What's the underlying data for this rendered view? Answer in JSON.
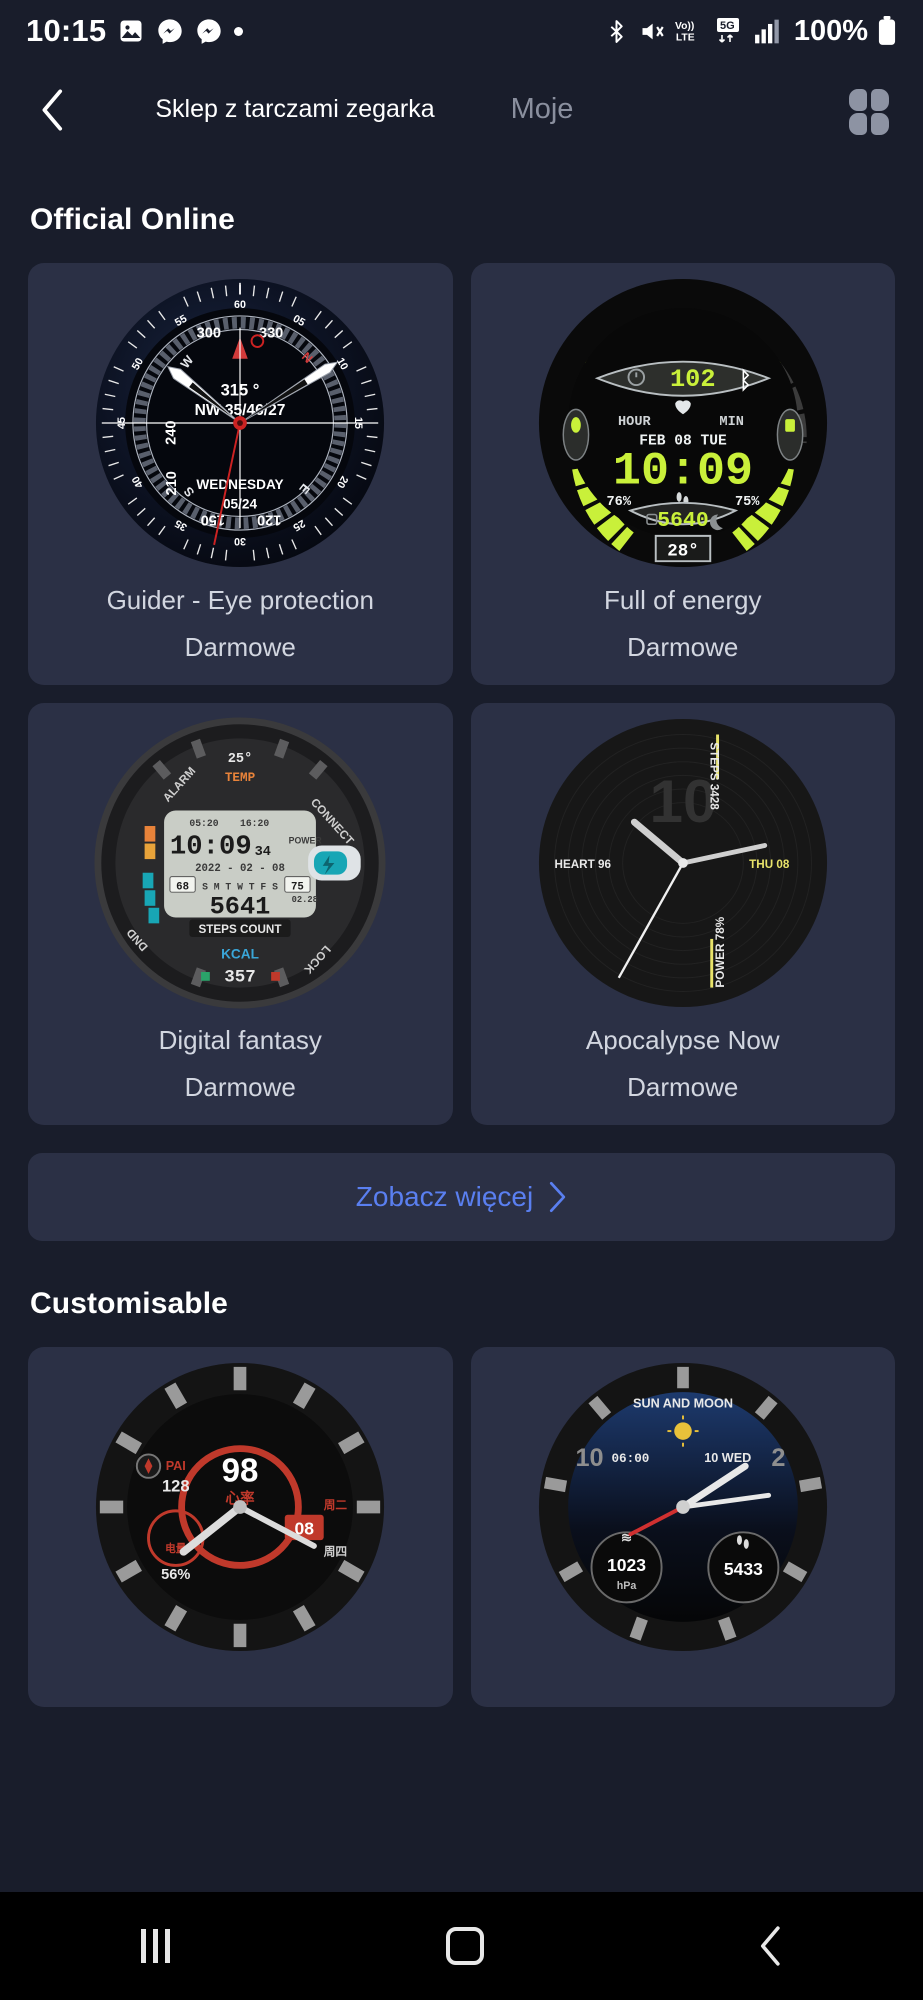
{
  "status_bar": {
    "time": "10:15",
    "battery_percent": "100%",
    "left_icons": [
      "photos-icon",
      "messenger-icon",
      "messenger-icon",
      "dot-icon"
    ],
    "right_icons": [
      "bluetooth-icon",
      "mute-icon",
      "volte-icon",
      "5g-icon",
      "signal-icon",
      "battery-icon"
    ],
    "network_volte_label": "Vo)) LTE",
    "network_5g_label": "5G"
  },
  "app_bar": {
    "back_icon": "chevron-left-icon",
    "title": "Sklep z tarczami zegarka",
    "tab_label": "Moje",
    "grid_icon": "grid-apps-icon"
  },
  "sections": [
    {
      "id": "official-online",
      "title": "Official Online",
      "cards": [
        {
          "name": "Guider - Eye protection",
          "price": "Darmowe",
          "face": "compass"
        },
        {
          "name": "Full of energy",
          "price": "Darmowe",
          "face": "energy"
        },
        {
          "name": "Digital fantasy",
          "price": "Darmowe",
          "face": "digital"
        },
        {
          "name": "Apocalypse Now",
          "price": "Darmowe",
          "face": "apocalypse"
        }
      ],
      "more_label": "Zobacz więcej",
      "more_icon": "chevron-right-icon"
    },
    {
      "id": "customisable",
      "title": "Customisable",
      "cards": [
        {
          "name": "",
          "price": "",
          "face": "pai"
        },
        {
          "name": "",
          "price": "",
          "face": "sunmoon"
        }
      ]
    }
  ],
  "watch_faces": {
    "compass": {
      "bearing": "315",
      "bearing_unit": "°",
      "coords": "NW 35/46/27",
      "weekday": "WEDNESDAY",
      "date": "05/24",
      "compass_labels": [
        "300",
        "330",
        "240",
        "210",
        "150",
        "120"
      ],
      "cardinals": [
        "N",
        "W",
        "S",
        "E"
      ],
      "minute_ticks": [
        "60",
        "55",
        "50",
        "45",
        "40",
        "35",
        "30",
        "25",
        "20",
        "15",
        "10",
        "05"
      ]
    },
    "energy": {
      "alarm_value": "102",
      "hour_label": "HOUR",
      "min_label": "MIN",
      "date": "FEB 08 TUE",
      "time": "10:09",
      "left_percent": "76%",
      "right_percent": "75%",
      "steps": "5640",
      "temperature": "28°",
      "icons": [
        "alarm-icon",
        "bluetooth-icon",
        "heart-icon",
        "footsteps-icon",
        "lock-icon",
        "moon-icon",
        "water-drop-icon",
        "battery-icon"
      ]
    },
    "digital": {
      "temp_top": "25°",
      "temp_label": "TEMP",
      "alarm_label": "ALARM",
      "connect_label": "CONNECT",
      "time": "10:09",
      "seconds": "34",
      "alarm_times": [
        "05:20",
        "16:20"
      ],
      "date": "2022 - 02 - 08",
      "power_label": "POWER",
      "left_val": "68",
      "right_val": "75",
      "week_days": "S M T W T F S",
      "small_date": "02.28",
      "steps": "5641",
      "steps_label": "STEPS COUNT",
      "kcal_label": "KCAL",
      "kcal": "357",
      "dnd_label": "DND",
      "lock_label": "LOCK"
    },
    "apocalypse": {
      "hour_big": "10",
      "steps_label": "STEPS 3428",
      "heart_label": "HEART 96",
      "day_label": "THU 08",
      "power_label": "POWER 78%"
    },
    "pai": {
      "pai_label": "PAI",
      "pai_value": "128",
      "center_value": "98",
      "center_label": "心率",
      "date_value": "08",
      "percent": "56%",
      "side_labels": [
        "周二",
        "周四"
      ],
      "sub_label": "电量"
    },
    "sunmoon": {
      "title": "SUN AND MOON",
      "time_small": "06:00",
      "day_label": "10 WED",
      "pressure": "1023",
      "pressure_unit": "hPa",
      "steps": "5433"
    }
  },
  "nav_bar": {
    "recents_icon": "recents-icon",
    "home_icon": "home-icon",
    "back_icon": "back-icon"
  },
  "colors": {
    "background": "#191d2b",
    "card": "#2b3045",
    "accent_link": "#5a7ff0",
    "text_primary": "#ffffff",
    "text_secondary": "#d2d6e0",
    "text_muted": "#8a8f9e",
    "energy_green": "#c9f03a",
    "nav_bar": "#000000"
  }
}
